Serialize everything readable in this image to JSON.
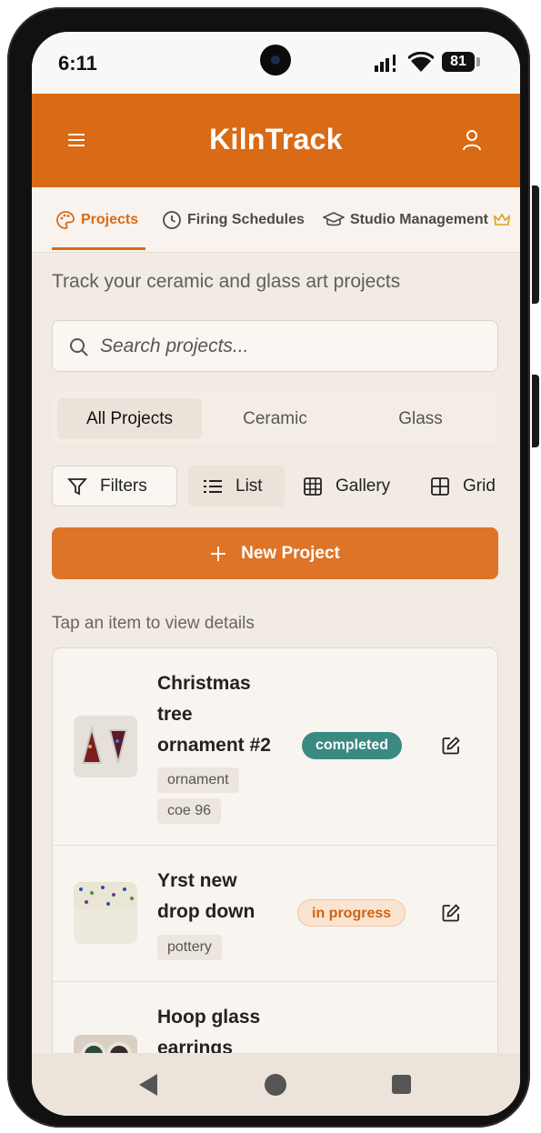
{
  "status_bar": {
    "time": "6:11",
    "battery": "81"
  },
  "app": {
    "title": "KilnTrack"
  },
  "tabs": [
    {
      "label": "Projects",
      "active": true
    },
    {
      "label": "Firing Schedules",
      "active": false
    },
    {
      "label": "Studio Management",
      "active": false
    }
  ],
  "page": {
    "subtitle": "Track your ceramic and glass art projects",
    "search_placeholder": "Search projects...",
    "hint": "Tap an item to view details"
  },
  "segments": [
    {
      "label": "All Projects",
      "selected": true
    },
    {
      "label": "Ceramic",
      "selected": false
    },
    {
      "label": "Glass",
      "selected": false
    }
  ],
  "toolbar": {
    "filters": "Filters",
    "list": "List",
    "gallery": "Gallery",
    "grid": "Grid"
  },
  "new_project": {
    "label": "New Project"
  },
  "projects": [
    {
      "name_lines": [
        "Christmas",
        "tree",
        "ornament #2"
      ],
      "status": "completed",
      "tags": [
        "ornament",
        "coe 96"
      ]
    },
    {
      "name_lines": [
        "Yrst new",
        "drop down"
      ],
      "status": "in progress",
      "tags": [
        "pottery"
      ]
    },
    {
      "name_lines": [
        "Hoop glass",
        "earrings"
      ],
      "status": "",
      "tags": []
    }
  ],
  "colors": {
    "brand": "#d96a16",
    "button": "#dd7427",
    "completed": "#3a8a82",
    "in_progress": "#d16210"
  }
}
